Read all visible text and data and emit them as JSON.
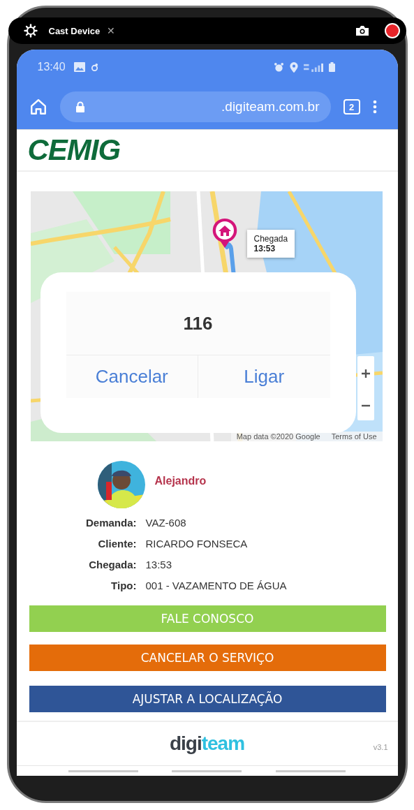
{
  "cast_bar": {
    "title": "Cast Device",
    "close_glyph": "✕"
  },
  "status_bar": {
    "time": "13:40"
  },
  "browser": {
    "url": ".digiteam.com.br",
    "tab_count": "2"
  },
  "header": {
    "logo": "CEMIG"
  },
  "map": {
    "tooltip": {
      "label": "Chegada",
      "time": "13:53"
    },
    "attribution": "Map data ©2020 Google",
    "terms": "Terms of Use"
  },
  "dialog": {
    "number": "116",
    "buttons": [
      {
        "label": "Cancelar"
      },
      {
        "label": "Ligar"
      }
    ]
  },
  "technician": {
    "name": "Alejandro"
  },
  "details": [
    {
      "label": "Demanda:",
      "value": "VAZ-608"
    },
    {
      "label": "Cliente:",
      "value": "RICARDO FONSECA"
    },
    {
      "label": "Chegada:",
      "value": "13:53"
    },
    {
      "label": "Tipo:",
      "value": "001 - VAZAMENTO DE ÁGUA"
    }
  ],
  "actions": [
    {
      "label": "FALE CONOSCO",
      "color": "#92d050"
    },
    {
      "label": "CANCELAR O SERVIÇO",
      "color": "#e46c0a"
    },
    {
      "label": "AJUSTAR A LOCALIZAÇÃO",
      "color": "#2f5597"
    }
  ],
  "footer": {
    "logo_dark": "digi",
    "logo_light": "team",
    "version": "v3.1"
  }
}
